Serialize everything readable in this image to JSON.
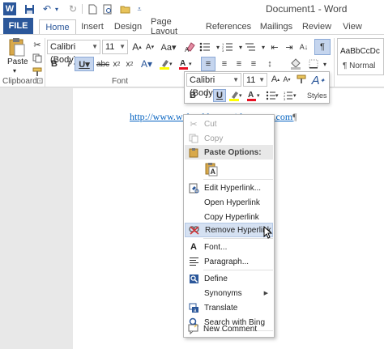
{
  "window": {
    "title": "Document1 - Word"
  },
  "tabs": [
    {
      "label": "FILE"
    },
    {
      "label": "Home"
    },
    {
      "label": "Insert"
    },
    {
      "label": "Design"
    },
    {
      "label": "Page Layout"
    },
    {
      "label": "References"
    },
    {
      "label": "Mailings"
    },
    {
      "label": "Review"
    },
    {
      "label": "View"
    }
  ],
  "ribbon": {
    "paste_label": "Paste",
    "font_name": "Calibri (Body)",
    "font_size": "11",
    "clipboard_label": "Clipboard",
    "clipboard_launcher": "⊡",
    "font_label": "Font",
    "styles_preview": "AaBbCcDc",
    "styles_name": "¶ Normal"
  },
  "mini_toolbar": {
    "font_name": "Calibri (Body)",
    "font_size": "11",
    "styles_label": "Styles"
  },
  "document": {
    "hyperlink_text": "http://www.web-address-with-spaces.com",
    "pilcrow": "¶"
  },
  "context_menu": {
    "items": [
      {
        "label": "Cut",
        "icon": "scissors-icon",
        "state": "disabled"
      },
      {
        "label": "Copy",
        "icon": "copy-icon",
        "state": "disabled"
      },
      {
        "label": "Paste Options:",
        "icon": "clipboard-icon",
        "state": "header"
      },
      {
        "label": "",
        "icon": "paste-keep-text-icon",
        "state": "normal"
      },
      {
        "label": "Edit Hyperlink...",
        "icon": "edit-hyperlink-icon",
        "state": "normal"
      },
      {
        "label": "Open Hyperlink",
        "icon": "",
        "state": "normal"
      },
      {
        "label": "Copy Hyperlink",
        "icon": "",
        "state": "normal"
      },
      {
        "label": "Remove Hyperlink",
        "icon": "remove-hyperlink-icon",
        "state": "hover"
      },
      {
        "label": "Font...",
        "icon": "font-icon",
        "state": "normal"
      },
      {
        "label": "Paragraph...",
        "icon": "paragraph-icon",
        "state": "normal"
      },
      {
        "label": "Define",
        "icon": "define-icon",
        "state": "normal"
      },
      {
        "label": "Synonyms",
        "icon": "",
        "state": "submenu"
      },
      {
        "label": "Translate",
        "icon": "translate-icon",
        "state": "normal"
      },
      {
        "label": "Search with Bing",
        "icon": "search-icon",
        "state": "normal"
      },
      {
        "label": "New Comment",
        "icon": "comment-icon",
        "state": "normal"
      }
    ]
  },
  "colors": {
    "accent": "#2b579a",
    "hyperlink": "#0563c1",
    "hover": "#d5e1f2"
  }
}
